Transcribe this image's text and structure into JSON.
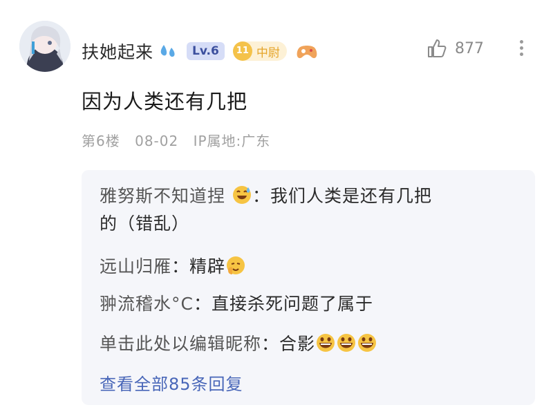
{
  "user": {
    "name": "扶她起来",
    "level": "Lv.6",
    "rank_number": "11",
    "rank_title": "中尉"
  },
  "like": {
    "count": "877"
  },
  "comment": {
    "text": "因为人类还有几把",
    "floor": "第6楼",
    "date": "08-02",
    "location": "IP属地:广东"
  },
  "replies": [
    {
      "user": "雅努斯不知道捏",
      "separator": "：",
      "text_line1": "我们人类是还有几把",
      "text_line2": "的（错乱）",
      "emoji": "sweat-smile-icon"
    },
    {
      "user": "远山归雁",
      "separator": "：",
      "text": "精辟",
      "emoji": "thumbs-up-face-icon"
    },
    {
      "user": "翀流稽水°C",
      "separator": "：",
      "text": "直接杀死问题了属于"
    },
    {
      "user": "单击此处以编辑昵称",
      "separator": "：",
      "text": "合影",
      "emoji": "grin-face-icon"
    }
  ],
  "view_all": "查看全部85条回复",
  "colors": {
    "accent": "#4866b8",
    "level_bg": "#d6ddf7",
    "rank_bg": "#fdf1d6"
  }
}
